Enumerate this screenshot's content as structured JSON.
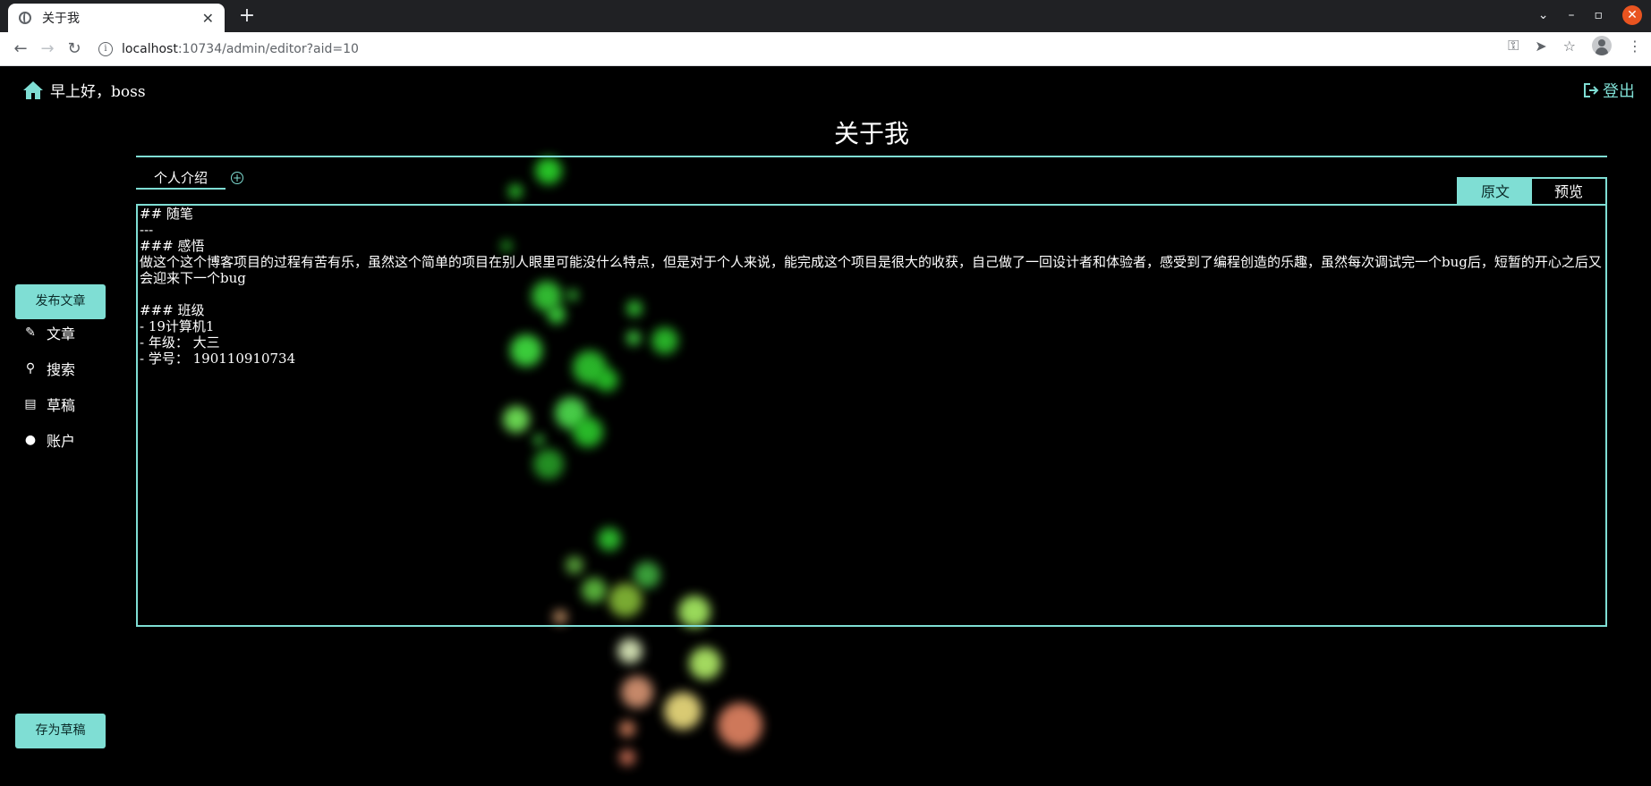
{
  "browser": {
    "tab_title": "关于我",
    "url_host": "localhost",
    "url_rest": ":10734/admin/editor?aid=10"
  },
  "header": {
    "greeting": "早上好，boss",
    "logout": "登出"
  },
  "sidebar": {
    "publish_button": "发布文章",
    "items": [
      {
        "label": "文章",
        "icon": "edit-icon"
      },
      {
        "label": "搜索",
        "icon": "search-icon"
      },
      {
        "label": "草稿",
        "icon": "draft-icon"
      },
      {
        "label": "账户",
        "icon": "user-icon"
      }
    ],
    "save_draft_button": "存为草稿"
  },
  "editor": {
    "title": "关于我",
    "doc_tab": "个人介绍",
    "add_tab_icon": "add-circle-icon",
    "mode_tabs": [
      {
        "label": "原文",
        "active": true
      },
      {
        "label": "预览",
        "active": false
      }
    ],
    "lines": [
      "## 随笔",
      "---",
      "### 感悟",
      "做这个这个博客项目的过程有苦有乐，虽然这个简单的项目在别人眼里可能没什么特点，但是对于个人来说，能完成这个项目是很大的收获，自己做了一回设计者和体验者，感受到了编程创造的乐趣，虽然每次调试完一个bug后，短暂的开心之后又会迎来下一个bug",
      "",
      "### 班级",
      "- 19计算机1",
      "- 年级： 大三",
      "- 学号： 190110910734"
    ]
  },
  "colors": {
    "accent": "#7fded4",
    "background": "#000000"
  }
}
